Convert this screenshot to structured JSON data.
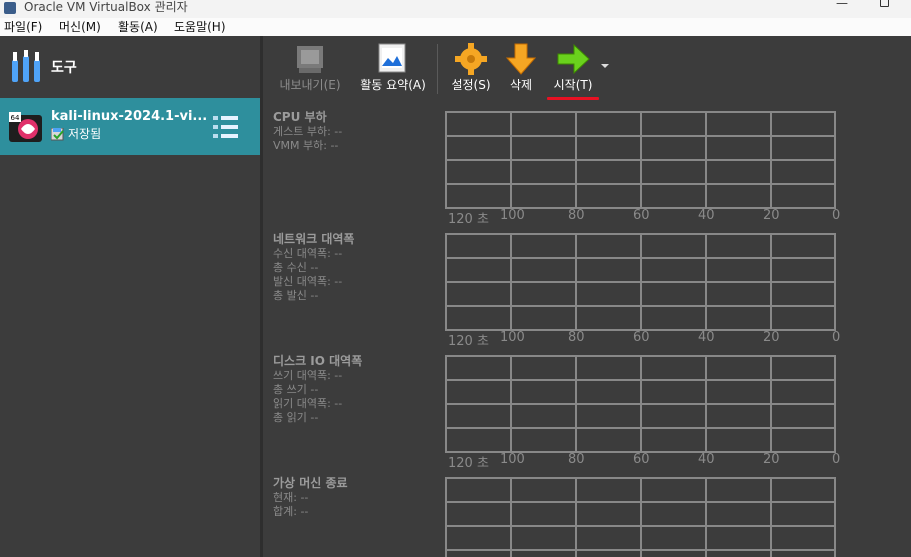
{
  "window": {
    "title": "Oracle VM VirtualBox 관리자",
    "minimize": "—"
  },
  "menu": [
    "파일(F)",
    "머신(M)",
    "활동(A)",
    "도움말(H)"
  ],
  "sidebar": {
    "tools_label": "도구",
    "vm": {
      "name": "kali-linux-2024.1-vi...",
      "state": "저장됨",
      "badge": "64"
    }
  },
  "toolbar": {
    "export": "내보내기(E)",
    "activity_overview": "활동 요약(A)",
    "settings": "설정(S)",
    "delete": "삭제",
    "start": "시작(T)"
  },
  "sections": [
    {
      "title": "CPU 부하",
      "lines": [
        "게스트 부하: --",
        "VMM 부하: --"
      ]
    },
    {
      "title": "네트워크 대역폭",
      "lines": [
        "수신 대역폭: --",
        "총 수신 --",
        "발신 대역폭: --",
        "총 발신 --"
      ]
    },
    {
      "title": "디스크 IO 대역폭",
      "lines": [
        "쓰기 대역폭: --",
        "총 쓰기 --",
        "읽기 대역폭: --",
        "총 읽기 --"
      ]
    },
    {
      "title": "가상 머신 종료",
      "lines": [
        "현재: --",
        "합계: --"
      ]
    }
  ],
  "axis": {
    "first": "120 초",
    "ticks": [
      "100",
      "80",
      "60",
      "40",
      "20",
      "0"
    ]
  },
  "colors": {
    "selected": "#2e8f9d",
    "background": "#3c3c3c",
    "start_underline": "#e81123"
  }
}
